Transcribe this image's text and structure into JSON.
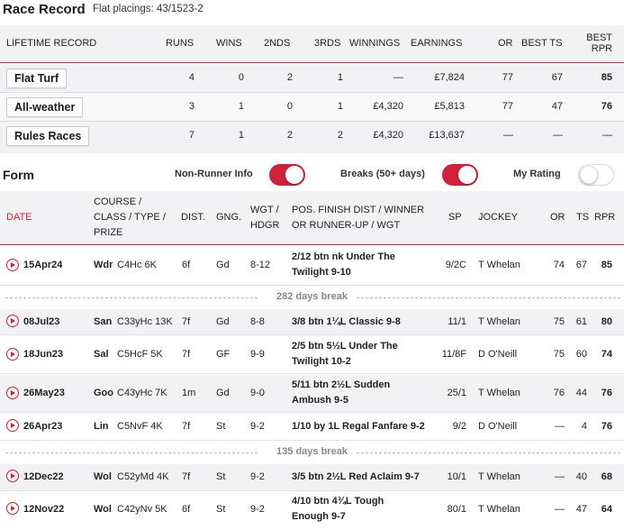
{
  "header": {
    "title": "Race Record",
    "subtitle": "Flat placings: 43/1523-2"
  },
  "lifetime": {
    "columns": {
      "record": "LIFETIME RECORD",
      "runs": "RUNS",
      "wins": "WINS",
      "nds": "2NDS",
      "rds": "3RDS",
      "winnings": "WINNINGS",
      "earnings": "EARNINGS",
      "or": "OR",
      "best_ts": "BEST TS",
      "best_rpr_1": "BEST",
      "best_rpr_2": "RPR"
    },
    "rows": [
      {
        "label": "Flat Turf",
        "runs": "4",
        "wins": "0",
        "nds": "2",
        "rds": "1",
        "winnings": "—",
        "earnings": "£7,824",
        "or": "77",
        "ts": "67",
        "rpr": "85"
      },
      {
        "label": "All-weather",
        "runs": "3",
        "wins": "1",
        "nds": "0",
        "rds": "1",
        "winnings": "£4,320",
        "earnings": "£5,813",
        "or": "77",
        "ts": "47",
        "rpr": "76"
      },
      {
        "label": "Rules Races",
        "runs": "7",
        "wins": "1",
        "nds": "2",
        "rds": "2",
        "winnings": "£4,320",
        "earnings": "£13,637",
        "or": "—",
        "ts": "—",
        "rpr": "—"
      }
    ]
  },
  "form": {
    "title": "Form",
    "toggles": {
      "non_runner": "Non-Runner Info",
      "breaks": "Breaks (50+ days)",
      "my_rating": "My Rating"
    },
    "columns": {
      "date": "DATE",
      "course_1": "COURSE /",
      "course_2": "CLASS / TYPE /",
      "course_3": "PRIZE",
      "dist": "DIST.",
      "going": "GNG.",
      "wgt_1": "WGT /",
      "wgt_2": "HDGR",
      "pos_1": "POS. FINISH DIST / WINNER",
      "pos_2": "OR RUNNER-UP / WGT",
      "sp": "SP",
      "jockey": "JOCKEY",
      "or": "OR",
      "ts": "TS",
      "rpr": "RPR"
    },
    "rows": [
      {
        "date": "15Apr24",
        "course": "Wdr",
        "cls": "C4Hc 6K",
        "dist": "6f",
        "going": "Gd",
        "wgt": "8-12",
        "pos1": "2/12 btn nk Under The",
        "pos2": "Twilight 9-10",
        "sp": "9/2C",
        "jockey": "T Whelan",
        "or": "74",
        "ts": "67",
        "rpr": "85"
      },
      {
        "date": "08Jul23",
        "course": "San",
        "cls": "C33yHc 13K",
        "dist": "7f",
        "going": "Gd",
        "wgt": "8-8",
        "pos1": "3/8 btn 1¼L Classic 9-8",
        "pos2": "",
        "sp": "11/1",
        "jockey": "T Whelan",
        "or": "75",
        "ts": "61",
        "rpr": "80"
      },
      {
        "date": "18Jun23",
        "course": "Sal",
        "cls": "C5HcF 5K",
        "dist": "7f",
        "going": "GF",
        "wgt": "9-9",
        "pos1": "2/5 btn 5½L Under The",
        "pos2": "Twilight 10-2",
        "sp": "11/8F",
        "jockey": "D O'Neill",
        "or": "75",
        "ts": "60",
        "rpr": "74"
      },
      {
        "date": "26May23",
        "course": "Goo",
        "cls": "C43yHc 7K",
        "dist": "1m",
        "going": "Gd",
        "wgt": "9-0",
        "pos1": "5/11 btn 2½L Sudden",
        "pos2": "Ambush 9-5",
        "sp": "25/1",
        "jockey": "T Whelan",
        "or": "76",
        "ts": "44",
        "rpr": "76"
      },
      {
        "date": "26Apr23",
        "course": "Lin",
        "cls": "C5NvF 4K",
        "dist": "7f",
        "going": "St",
        "wgt": "9-2",
        "pos1": "1/10 by 1L Regal Fanfare 9-2",
        "pos2": "",
        "sp": "9/2",
        "jockey": "D O'Neill",
        "or": "—",
        "ts": "4",
        "rpr": "76"
      },
      {
        "date": "12Dec22",
        "course": "Wol",
        "cls": "C52yMd 4K",
        "dist": "7f",
        "going": "St",
        "wgt": "9-2",
        "pos1": "3/5 btn 2½L Red Aclaim 9-7",
        "pos2": "",
        "sp": "10/1",
        "jockey": "T Whelan",
        "or": "—",
        "ts": "40",
        "rpr": "68"
      },
      {
        "date": "12Nov22",
        "course": "Wol",
        "cls": "C42yNv 5K",
        "dist": "6f",
        "going": "St",
        "wgt": "9-2",
        "pos1": "4/10 btn 4¾L Tough",
        "pos2": "Enough 9-7",
        "sp": "80/1",
        "jockey": "T Whelan",
        "or": "—",
        "ts": "47",
        "rpr": "64"
      }
    ],
    "breaks": [
      "282 days break",
      "135 days break"
    ]
  },
  "colors": {
    "accent": "#d0213a",
    "header_bg": "#f2f2f4",
    "break_text": "#888888"
  }
}
